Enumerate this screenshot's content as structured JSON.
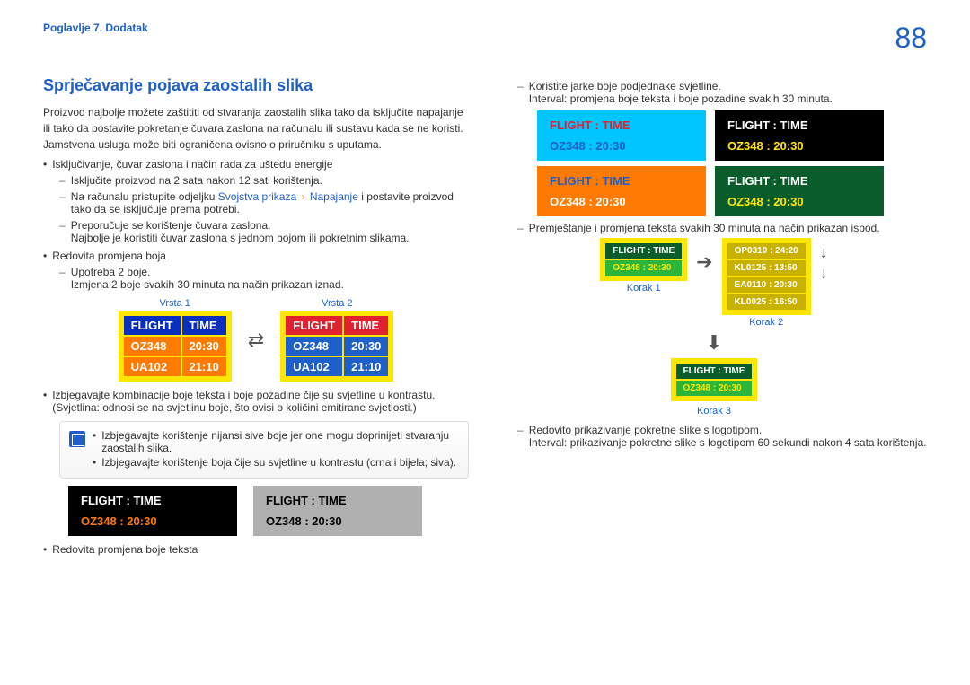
{
  "header": {
    "chapter": "Poglavlje 7. Dodatak",
    "page": "88"
  },
  "section_title": "Sprječavanje pojava zaostalih slika",
  "intro": [
    "Proizvod najbolje možete zaštititi od stvaranja zaostalih slika tako da isključite napajanje ili tako da postavite pokretanje čuvara zaslona na računalu ili sustavu kada se ne koristi. Jamstvena usluga može biti ograničena ovisno o priručniku s uputama."
  ],
  "b1": "Isključivanje, čuvar zaslona i način rada za uštedu energije",
  "b1_d1": "Isključite proizvod na 2 sata nakon 12 sati korištenja.",
  "b1_d2_pre": "Na računalu pristupite odjeljku ",
  "b1_d2_link1": "Svojstva prikaza",
  "b1_d2_sep": "›",
  "b1_d2_link2": "Napajanje",
  "b1_d2_post": " i postavite proizvod tako da se isključuje prema potrebi.",
  "b1_d3": "Preporučuje se korištenje čuvara zaslona.",
  "b1_d3b": "Najbolje je koristiti čuvar zaslona s jednom bojom ili pokretnim slikama.",
  "b2": "Redovita promjena boja",
  "b2_d1": "Upotreba 2 boje.",
  "b2_d1b": "Izmjena 2 boje svakih 30 minuta na način prikazan iznad.",
  "vrsta1": "Vrsta 1",
  "vrsta2": "Vrsta 2",
  "flight": "FLIGHT",
  "time": "TIME",
  "oz": "OZ348",
  "t2030": "20:30",
  "ua": "UA102",
  "t2110": "21:10",
  "flight_time": "FLIGHT    :   TIME",
  "oz_time": "OZ348    :   20:30",
  "b3": "Izbjegavajte kombinacije boje teksta i boje pozadine čije su svjetline u kontrastu. (Svjetlina: odnosi se na svjetlinu boje, što ovisi o količini emitirane svjetlosti.)",
  "note1": "Izbjegavajte korištenje nijansi sive boje jer one mogu doprinijeti stvaranju zaostalih slika.",
  "note2": "Izbjegavajte korištenje boja čije su svjetline u kontrastu (crna i bijela; siva).",
  "b4": "Redovita promjena boje teksta",
  "r_d1": "Koristite jarke boje podjednake svjetline.",
  "r_d1b": "Interval: promjena boje teksta i boje pozadine svakih 30 minuta.",
  "r_d2": "Premještanje i promjena teksta svakih 30 minuta na način prikazan ispod.",
  "korak1": "Korak 1",
  "korak2": "Korak 2",
  "korak3": "Korak 3",
  "k2_r1": "OP0310   :   24:20",
  "k2_r2": "KL0125   :   13:50",
  "k2_r3": "EA0110   :   20:30",
  "k2_r4": "KL0025   :   16:50",
  "r_d3": "Redovito prikazivanje pokretne slike s logotipom.",
  "r_d3b": "Interval: prikazivanje pokretne slike s logotipom 60 sekundi nakon 4 sata korištenja."
}
